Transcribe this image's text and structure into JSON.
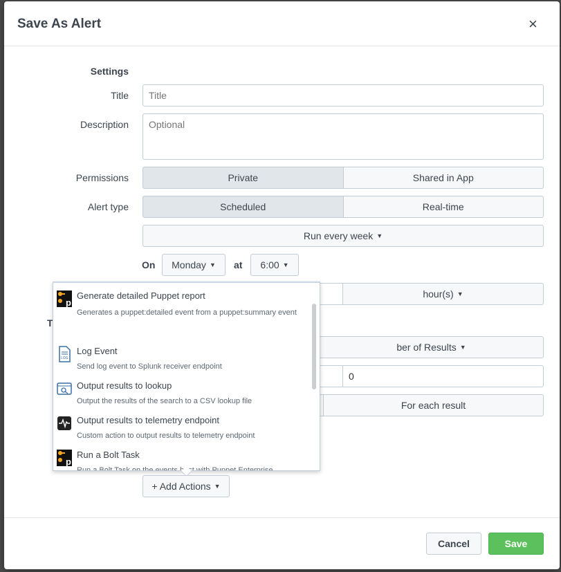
{
  "dialog": {
    "title": "Save As Alert",
    "close": "×"
  },
  "settings": {
    "heading": "Settings",
    "title_label": "Title",
    "title_placeholder": "Title",
    "description_label": "Description",
    "description_placeholder": "Optional",
    "permissions_label": "Permissions",
    "permissions": [
      "Private",
      "Shared in App"
    ],
    "alert_type_label": "Alert type",
    "alert_types": [
      "Scheduled",
      "Real-time"
    ],
    "run_every": "Run every week",
    "on_label": "On",
    "day": "Monday",
    "at_label": "at",
    "time": "6:00",
    "period_unit": "hour(s)",
    "trigger_condition": "ber of Results",
    "trigger_value": "0",
    "trigger_mode": "For each result",
    "hidden_label_t": "T"
  },
  "actions_menu": {
    "items": [
      {
        "name": "Generate detailed Puppet report",
        "desc": "Generates a puppet:detailed event from a puppet:summary event",
        "icon": "puppet-icon"
      },
      {
        "name": "Log Event",
        "desc": "Send log event to Splunk receiver endpoint",
        "icon": "log-icon"
      },
      {
        "name": "Output results to lookup",
        "desc": "Output the results of the search to a CSV lookup file",
        "icon": "lookup-icon"
      },
      {
        "name": "Output results to telemetry endpoint",
        "desc": "Custom action to output results to telemetry endpoint",
        "icon": "telemetry-icon"
      },
      {
        "name": "Run a Bolt Task",
        "desc": "Run a Bolt Task on the events host with Puppet Enterprise",
        "icon": "puppet-icon"
      }
    ]
  },
  "add_actions": "+ Add Actions",
  "footer": {
    "cancel": "Cancel",
    "save": "Save"
  },
  "colors": {
    "save_green": "#5cc05c",
    "active_segment": "#e1e6eb",
    "border": "#c3cbd4"
  }
}
